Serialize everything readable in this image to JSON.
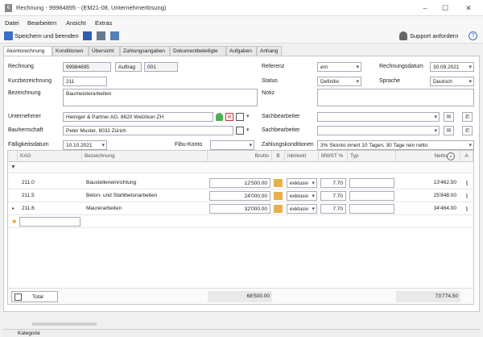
{
  "window": {
    "title": "Rechnung - 99984895 - (EM21-08, Unternehmerlösung)",
    "app_icon": "€"
  },
  "menu": [
    "Datei",
    "Bearbeiten",
    "Ansicht",
    "Extras"
  ],
  "toolbar": {
    "save_close": "Speichern und beenden",
    "support": "Support anfordern"
  },
  "tabs": [
    "Akontorechnung",
    "Konditionen",
    "Übersicht",
    "Zahlungsangaben",
    "Dokumentbeteiligte",
    "Aufgaben",
    "Anhang"
  ],
  "form": {
    "rechnung_label": "Rechnung",
    "rechnung_value": "99984895",
    "auftrag_label": "Auftrag",
    "auftrag_value": "001",
    "kurz_label": "Kurzbezeichnung",
    "kurz_value": "211",
    "bez_label": "Bezeichnung",
    "bez_value": "Baumeisterarbeiten",
    "unternehmer_label": "Unternehmer",
    "unternehmer_value": "Heiniger & Partner AG, 8620 Wetzikon ZH",
    "bauherr_label": "Bauherrschaft",
    "bauherr_value": "Peter Muster, 8032 Zürich",
    "faellig_label": "Fälligkeitsdatum",
    "faellig_value": "10.10.2021",
    "fibu_label": "Fibu-Konto",
    "fibu_value": "",
    "referenz_label": "Referenz",
    "referenz_value": "em",
    "rdatum_label": "Rechnungsdatum",
    "rdatum_value": "30.09.2021",
    "status_label": "Status",
    "status_value": "Definitiv",
    "sprache_label": "Sprache",
    "sprache_value": "Deutsch",
    "notiz_label": "Notiz",
    "notiz_value": "",
    "sachbearbeiter_label": "Sachbearbeiter",
    "sachbearbeiter1_value": "",
    "sachbearbeiter2_value": "",
    "zk_label": "Zahlungskonditionen",
    "zk_value": "3% Skonto innert 10 Tagen, 30 Tage rein netto"
  },
  "grid": {
    "headers": {
      "kag": "KAG",
      "bez": "Bezeichnung",
      "brutto": "Brutto",
      "b": "B",
      "inkl": "inkl/exkl",
      "mwst": "MWST %",
      "typ": "Typ",
      "netto": "Netto",
      "a": "A"
    },
    "rows": [
      {
        "kag": "211.0",
        "bez": "Baustelleneinrichtung",
        "brutto": "12'500.00",
        "inkl": "exklusiv",
        "mwst": "7.70",
        "typ": "",
        "netto": "13'462.50"
      },
      {
        "kag": "211.5",
        "bez": "Beton- und Stahlbetonarbeiten",
        "brutto": "24'000.00",
        "inkl": "exklusiv",
        "mwst": "7.70",
        "typ": "",
        "netto": "25'848.00"
      },
      {
        "kag": "211.6",
        "bez": "Maurerarbeiten",
        "brutto": "32'000.00",
        "inkl": "exklusiv",
        "mwst": "7.70",
        "typ": "",
        "netto": "34'464.00"
      }
    ],
    "new_row_marker": "✱",
    "total_label": "Total",
    "total_brutto": "68'500.00",
    "total_netto": "73'774.50"
  },
  "status": {
    "kategorie": "Kategorie"
  }
}
